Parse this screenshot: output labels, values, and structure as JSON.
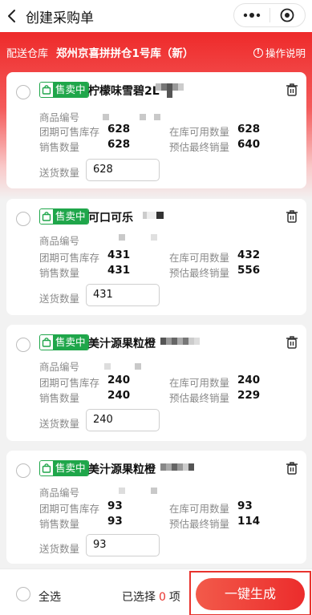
{
  "nav": {
    "title": "创建采购单"
  },
  "warehouse": {
    "label": "配送仓库",
    "name": "郑州京喜拼拼仓1号库（新）",
    "help": "操作说明"
  },
  "labels": {
    "sku": "商品编号",
    "group_stock": "团期可售库存",
    "available_stock": "在库可用数量",
    "sales_qty": "销售数量",
    "est_final_sales": "预估最终销量",
    "delivery_qty": "送货数量"
  },
  "cards": [
    {
      "badge": "售卖中",
      "name": "柠檬味雪碧2L",
      "group_stock": "628",
      "available_stock": "628",
      "sales_qty": "628",
      "est_final_sales": "640",
      "delivery_qty": "628"
    },
    {
      "badge": "售卖中",
      "name": "可口可乐",
      "group_stock": "431",
      "available_stock": "432",
      "sales_qty": "431",
      "est_final_sales": "556",
      "delivery_qty": "431"
    },
    {
      "badge": "售卖中",
      "name": "美汁源果粒橙",
      "group_stock": "240",
      "available_stock": "240",
      "sales_qty": "240",
      "est_final_sales": "229",
      "delivery_qty": "240"
    },
    {
      "badge": "售卖中",
      "name": "美汁源果粒橙",
      "group_stock": "93",
      "available_stock": "93",
      "sales_qty": "93",
      "est_final_sales": "114",
      "delivery_qty": "93"
    }
  ],
  "footer": {
    "select_all": "全选",
    "selected_prefix": "已选择",
    "selected_count": "0",
    "selected_suffix": "项",
    "generate": "一键生成"
  },
  "colors": {
    "brand_red": "#e8332e",
    "badge_green": "#1fa64a"
  },
  "icons": {
    "back": "chevron-left-icon",
    "more": "more-dots-icon",
    "close": "target-circle-icon",
    "info": "info-circle-icon",
    "badge": "shopping-bag-icon",
    "delete": "trash-icon"
  }
}
